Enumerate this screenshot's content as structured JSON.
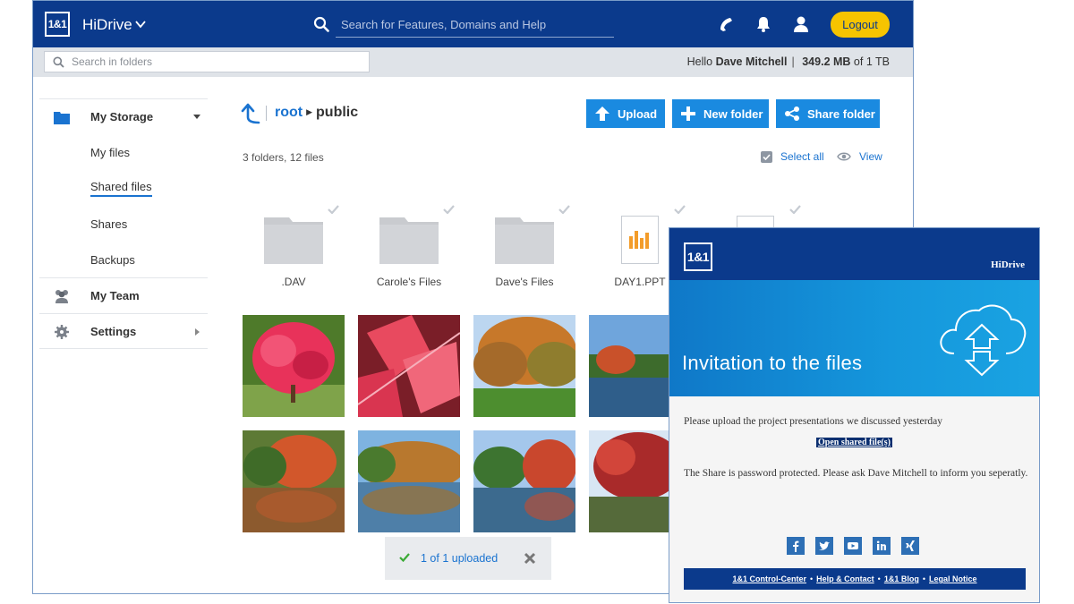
{
  "topbar": {
    "logo_text": "1&1",
    "app_name": "HiDrive",
    "search_placeholder": "Search for Features, Domains and Help",
    "logout_label": "Logout"
  },
  "subbar": {
    "folder_search_placeholder": "Search in folders",
    "greeting": "Hello",
    "user_name": "Dave Mitchell",
    "storage_used": "349.2 MB",
    "storage_of": "of 1 TB"
  },
  "sidebar": {
    "my_storage": "My Storage",
    "sub_items": [
      "My files",
      "Shared files",
      "Shares",
      "Backups"
    ],
    "active_sub_item": "Shared files",
    "my_team": "My Team",
    "settings": "Settings"
  },
  "breadcrumb": {
    "root": "root",
    "current": "public"
  },
  "toolbar": {
    "upload": "Upload",
    "new_folder": "New folder",
    "share_folder": "Share folder"
  },
  "content": {
    "count_text": "3 folders, 12 files",
    "select_all": "Select all",
    "view": "View",
    "items": [
      {
        "name": ".DAV",
        "type": "folder"
      },
      {
        "name": "Carole's Files",
        "type": "folder"
      },
      {
        "name": "Dave's Files",
        "type": "folder"
      },
      {
        "name": "DAY1.PPT",
        "type": "presentation"
      }
    ]
  },
  "toast": {
    "text": "1 of 1 uploaded"
  },
  "email": {
    "logo_text": "1&1",
    "brand": "HiDrive",
    "title": "Invitation to the files",
    "message": "Please upload the project presentations we discussed yesterday",
    "open_link": "Open shared file(s)",
    "note": "The Share is password protected. Please ask Dave Mitchell to inform you seperatly.",
    "social": [
      "facebook",
      "twitter",
      "youtube",
      "linkedin",
      "xing"
    ],
    "footer_links": [
      "1&1 Control-Center",
      "Help & Contact",
      "1&1 Blog",
      "Legal Notice"
    ]
  },
  "colors": {
    "brand_blue": "#0b3a8c",
    "accent_blue": "#1a8ae0",
    "logout_yellow": "#f6c400",
    "banner_blue": "#1597dc"
  }
}
